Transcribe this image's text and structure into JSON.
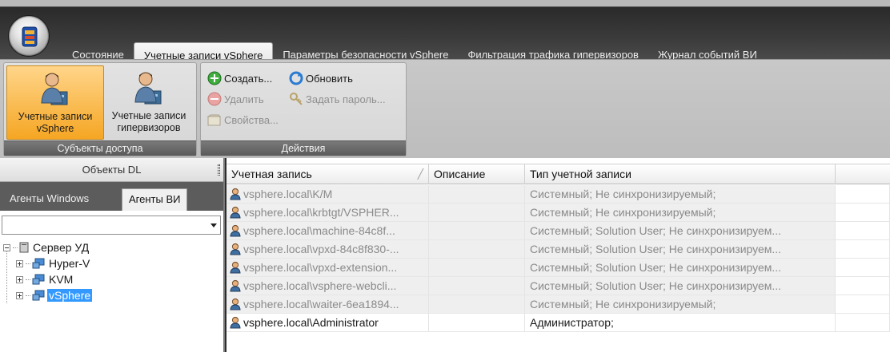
{
  "tabs": [
    "Состояние",
    "Учетные записи vSphere",
    "Параметры безопасности vSphere",
    "Фильтрация трафика гипервизоров",
    "Журнал событий ВИ"
  ],
  "ribbon": {
    "subjects_group": {
      "title": "Субъекты доступа",
      "vsphere_accounts": "Учетные записи vSphere",
      "hypervisor_accounts": "Учетные записи гипервизоров"
    },
    "actions_group": {
      "title": "Действия",
      "create": "Создать...",
      "refresh": "Обновить",
      "delete": "Удалить",
      "set_password": "Задать пароль...",
      "properties": "Свойства..."
    }
  },
  "left_panel": {
    "header": "Объекты DL",
    "tabs": [
      "Агенты Windows",
      "Агенты ВИ"
    ],
    "combo_value": "",
    "tree": {
      "root": "Сервер УД",
      "children": [
        "Hyper-V",
        "KVM",
        "vSphere"
      ]
    }
  },
  "grid": {
    "columns": [
      "Учетная запись",
      "Описание",
      "Тип учетной записи"
    ],
    "rows": [
      {
        "account": "vsphere.local\\K/M",
        "description": "",
        "type": "Системный; Не синхронизируемый;"
      },
      {
        "account": "vsphere.local\\krbtgt/VSPHER...",
        "description": "",
        "type": "Системный; Не синхронизируемый;"
      },
      {
        "account": "vsphere.local\\machine-84c8f...",
        "description": "",
        "type": "Системный; Solution User; Не синхронизируем..."
      },
      {
        "account": "vsphere.local\\vpxd-84c8f830-...",
        "description": "",
        "type": "Системный; Solution User; Не синхронизируем..."
      },
      {
        "account": "vsphere.local\\vpxd-extension...",
        "description": "",
        "type": "Системный; Solution User; Не синхронизируем..."
      },
      {
        "account": "vsphere.local\\vsphere-webcli...",
        "description": "",
        "type": "Системный; Solution User; Не синхронизируем..."
      },
      {
        "account": "vsphere.local\\waiter-6ea1894...",
        "description": "",
        "type": "Системный; Не синхронизируемый;"
      },
      {
        "account": "vsphere.local\\Administrator",
        "description": "",
        "type": "Администратор;"
      }
    ]
  },
  "colors": {
    "accent_active": "#f5a623",
    "selection": "#3399ff",
    "system_row_text": "#8a8a8a"
  }
}
